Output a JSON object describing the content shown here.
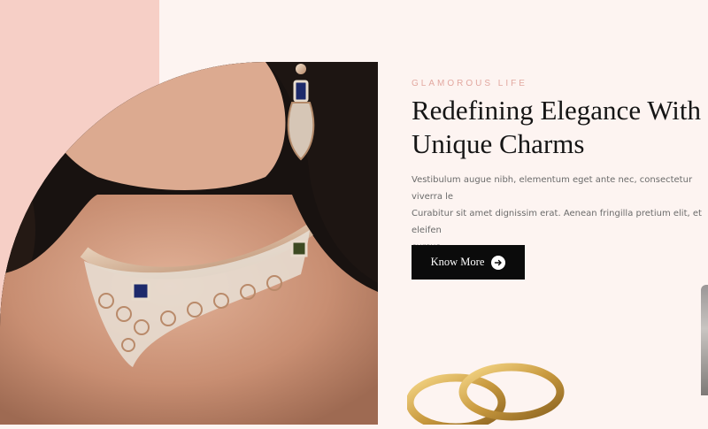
{
  "hero": {
    "eyebrow": "GLAMOROUS LIFE",
    "headline": "Redefining Elegance With\nUnique Charms",
    "body": "Vestibulum augue nibh, elementum eget ante nec, consectetur viverra le\nCurabitur sit amet dignissim erat. Aenean fringilla pretium elit, et eleifen\ncursus.",
    "cta_label": "Know More",
    "cta_icon": "arrow-right-circle-icon"
  },
  "colors": {
    "page_bg": "#fdf4f1",
    "accent_pink": "#f6cfc6",
    "eyebrow": "#e2a8a0",
    "button_bg": "#0b0b0b"
  }
}
